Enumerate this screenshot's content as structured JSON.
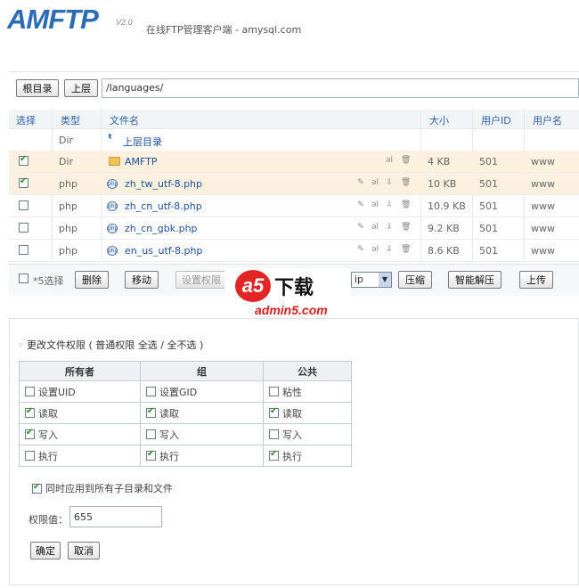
{
  "header": {
    "logo": "AMFTP",
    "version": "V2.0",
    "tagline": "在线FTP管理客户端 - amysql.com"
  },
  "toolbar": {
    "root_button": "根目录",
    "up_button": "上层",
    "path_value": "/languages/"
  },
  "file_table": {
    "columns": [
      "选择",
      "类型",
      "文件名",
      "大小",
      "用户ID",
      "用户名"
    ],
    "parent_row": {
      "type": "Dir",
      "name": "上层目录"
    },
    "rows": [
      {
        "selected": true,
        "type": "Dir",
        "name": "AMFTP",
        "size": "4 KB",
        "uid": "501",
        "user": "www"
      },
      {
        "selected": true,
        "type": "php",
        "name": "zh_tw_utf-8.php",
        "size": "10 KB",
        "uid": "501",
        "user": "www"
      },
      {
        "selected": false,
        "type": "php",
        "name": "zh_cn_utf-8.php",
        "size": "10.9 KB",
        "uid": "501",
        "user": "www"
      },
      {
        "selected": false,
        "type": "php",
        "name": "zh_cn_gbk.php",
        "size": "9.2 KB",
        "uid": "501",
        "user": "www"
      },
      {
        "selected": false,
        "type": "php",
        "name": "en_us_utf-8.php",
        "size": "8.6 KB",
        "uid": "501",
        "user": "www"
      }
    ]
  },
  "footer": {
    "select_count": "*5选择",
    "delete_button": "删除",
    "move_button": "移动",
    "chmod_button": "设置权限",
    "format_value": "ip",
    "compress_button": "压缩",
    "smart_extract_button": "智能解压",
    "upload_button": "上传"
  },
  "watermark": {
    "mark": "a5",
    "text": "下载",
    "url": "admin5.com"
  },
  "permissions": {
    "title": "更改文件权限 ( 普通权限 全选 / 全不选 )",
    "headers": [
      "所有者",
      "组",
      "公共"
    ],
    "rows": [
      [
        {
          "label": "设置UID",
          "checked": false
        },
        {
          "label": "设置GID",
          "checked": false
        },
        {
          "label": "粘性",
          "checked": false
        }
      ],
      [
        {
          "label": "读取",
          "checked": true
        },
        {
          "label": "读取",
          "checked": true
        },
        {
          "label": "读取",
          "checked": true
        }
      ],
      [
        {
          "label": "写入",
          "checked": true
        },
        {
          "label": "写入",
          "checked": false
        },
        {
          "label": "写入",
          "checked": false
        }
      ],
      [
        {
          "label": "执行",
          "checked": false
        },
        {
          "label": "执行",
          "checked": true
        },
        {
          "label": "执行",
          "checked": true
        }
      ]
    ],
    "recursive_label": "同时应用到所有子目录和文件",
    "recursive_checked": true,
    "mode_label": "权限值：",
    "mode_value": "655",
    "ok_button": "确定",
    "cancel_button": "取消"
  }
}
